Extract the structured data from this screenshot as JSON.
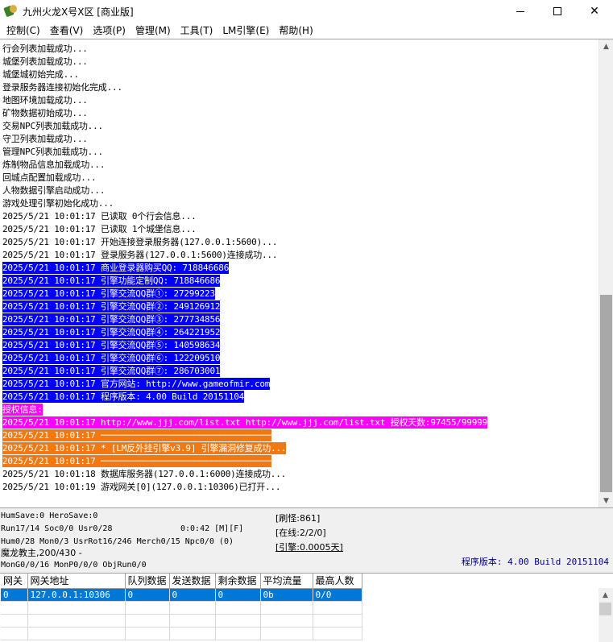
{
  "window": {
    "title": "九州火龙X号X区 [商业版]",
    "minimize": "─",
    "maximize": "☐",
    "close": "✕"
  },
  "menu": [
    {
      "label": "控制(C)"
    },
    {
      "label": "查看(V)"
    },
    {
      "label": "选项(P)"
    },
    {
      "label": "管理(M)"
    },
    {
      "label": "工具(T)"
    },
    {
      "label": "LM引擎(E)"
    },
    {
      "label": "帮助(H)"
    }
  ],
  "log": {
    "lines": [
      {
        "text": "行会列表加载成功...",
        "style": "plain"
      },
      {
        "text": "城堡列表加载成功...",
        "style": "plain"
      },
      {
        "text": "城堡城初始完成...",
        "style": "plain"
      },
      {
        "text": "登录服务器连接初始化完成...",
        "style": "plain"
      },
      {
        "text": "地图环境加载成功...",
        "style": "plain"
      },
      {
        "text": "矿物数据初始成功...",
        "style": "plain"
      },
      {
        "text": "交易NPC列表加载成功...",
        "style": "plain"
      },
      {
        "text": "守卫列表加载成功...",
        "style": "plain"
      },
      {
        "text": "管理NPC列表加载成功...",
        "style": "plain"
      },
      {
        "text": "炼制物品信息加载成功...",
        "style": "plain"
      },
      {
        "text": "回城点配置加载成功...",
        "style": "plain"
      },
      {
        "text": "人物数据引擎启动成功...",
        "style": "plain"
      },
      {
        "text": "游戏处理引擎初始化成功...",
        "style": "plain"
      },
      {
        "text": "2025/5/21 10:01:17 已读取 0个行会信息...",
        "style": "plain"
      },
      {
        "text": "2025/5/21 10:01:17 已读取 1个城堡信息...",
        "style": "plain"
      },
      {
        "text": "2025/5/21 10:01:17 开始连接登录服务器(127.0.0.1:5600)...",
        "style": "plain"
      },
      {
        "text": "2025/5/21 10:01:17 登录服务器(127.0.0.1:5600)连接成功...",
        "style": "plain"
      },
      {
        "text": "2025/5/21 10:01:17 商业登录器购买QQ: 718846686",
        "style": "blue"
      },
      {
        "text": "2025/5/21 10:01:17 引擎功能定制QQ: 718846686",
        "style": "blue"
      },
      {
        "text": "2025/5/21 10:01:17 引擎交流QQ群①: 27299223",
        "style": "blue"
      },
      {
        "text": "2025/5/21 10:01:17 引擎交流QQ群②: 249126912",
        "style": "blue"
      },
      {
        "text": "2025/5/21 10:01:17 引擎交流QQ群③: 277734856",
        "style": "blue"
      },
      {
        "text": "2025/5/21 10:01:17 引擎交流QQ群④: 264221952",
        "style": "blue"
      },
      {
        "text": "2025/5/21 10:01:17 引擎交流QQ群⑤: 140598634",
        "style": "blue"
      },
      {
        "text": "2025/5/21 10:01:17 引擎交流QQ群⑥: 122209510",
        "style": "blue"
      },
      {
        "text": "2025/5/21 10:01:17 引擎交流QQ群⑦: 286703001",
        "style": "blue"
      },
      {
        "text": "2025/5/21 10:01:17 官方网站: http://www.gameofmir.com",
        "style": "blue"
      },
      {
        "text": "2025/5/21 10:01:17 程序版本: 4.00 Build 20151104",
        "style": "blue"
      },
      {
        "text": "授权信息:",
        "style": "magenta"
      },
      {
        "text": "2025/5/21 10:01:17 http://www.jjj.com/list.txt http://www.jjj.com/list.txt 授权天数:97455/99999",
        "style": "magenta"
      },
      {
        "text": "2025/5/21 10:01:17 ─────────────────────────────────",
        "style": "orange"
      },
      {
        "text": "2025/5/21 10:01:17 * [LM反外挂引擎v3.9] 引擎漏洞修复成功...",
        "style": "orange"
      },
      {
        "text": "2025/5/21 10:01:17 ─────────────────────────────────",
        "style": "orange"
      },
      {
        "text": "2025/5/21 10:01:18 数据库服务器(127.0.0.1:6000)连接成功...",
        "style": "plain"
      },
      {
        "text": "2025/5/21 10:01:19 游戏网关[0](127.0.0.1:10306)已打开...",
        "style": "plain"
      }
    ]
  },
  "status": {
    "line1": "HumSave:0 HeroSave:0",
    "line2a": "Run17/14 Soc0/0 Usr0/28",
    "line2b": "0:0:42 [M][F]",
    "line3": "Hum0/28 Mon0/3 UsrRot16/246 Merch0/15 Npc0/0 (0)",
    "line4": "魔龙教主,200/430 -",
    "line5": "MonG0/0/16 MonP0/0/0 ObjRun0/0",
    "refresh": "[刷怪:861]",
    "online": "[在线:2/2/0]",
    "engine": "[引擎:0.0005天]",
    "version": "程序版本: 4.00 Build 20151104"
  },
  "gateway_table": {
    "columns": [
      "网关",
      "网关地址",
      "队列数据",
      "发送数据",
      "剩余数据",
      "平均流量",
      "最高人数"
    ],
    "rows": [
      [
        "0",
        "127.0.0.1:10306",
        "0",
        "0",
        "0",
        "0b",
        "0/0"
      ]
    ],
    "empty_rows": 3
  }
}
